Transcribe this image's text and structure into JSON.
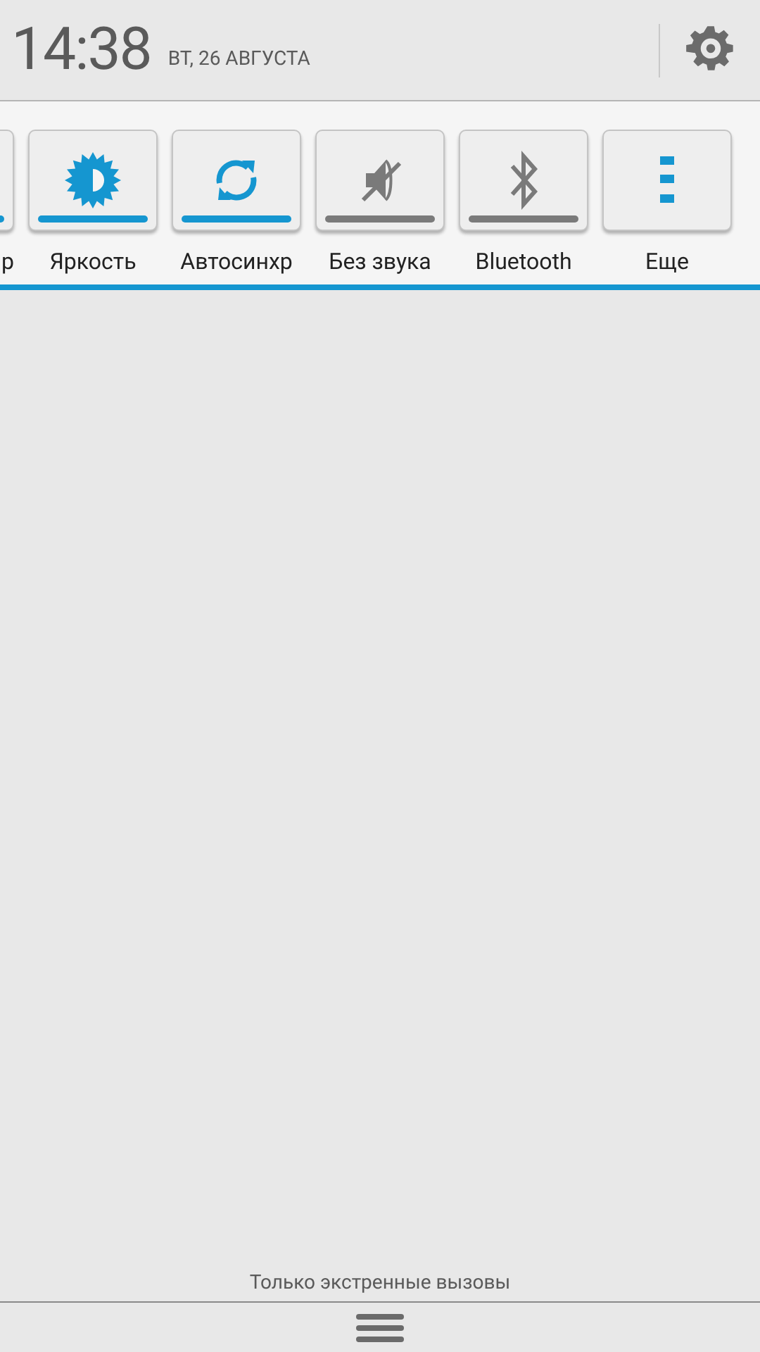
{
  "header": {
    "time": "14:38",
    "date": "ВТ, 26 АВГУСТА"
  },
  "tiles": [
    {
      "kind": "cut",
      "label": "р",
      "on": true
    },
    {
      "kind": "brightness",
      "label": "Яркость",
      "on": true
    },
    {
      "kind": "sync",
      "label": "Автосинхр",
      "on": true
    },
    {
      "kind": "mute",
      "label": "Без звука",
      "on": false
    },
    {
      "kind": "bluetooth",
      "label": "Bluetooth",
      "on": false
    },
    {
      "kind": "more",
      "label": "Еще"
    }
  ],
  "footer": {
    "status": "Только экстренные вызовы"
  }
}
